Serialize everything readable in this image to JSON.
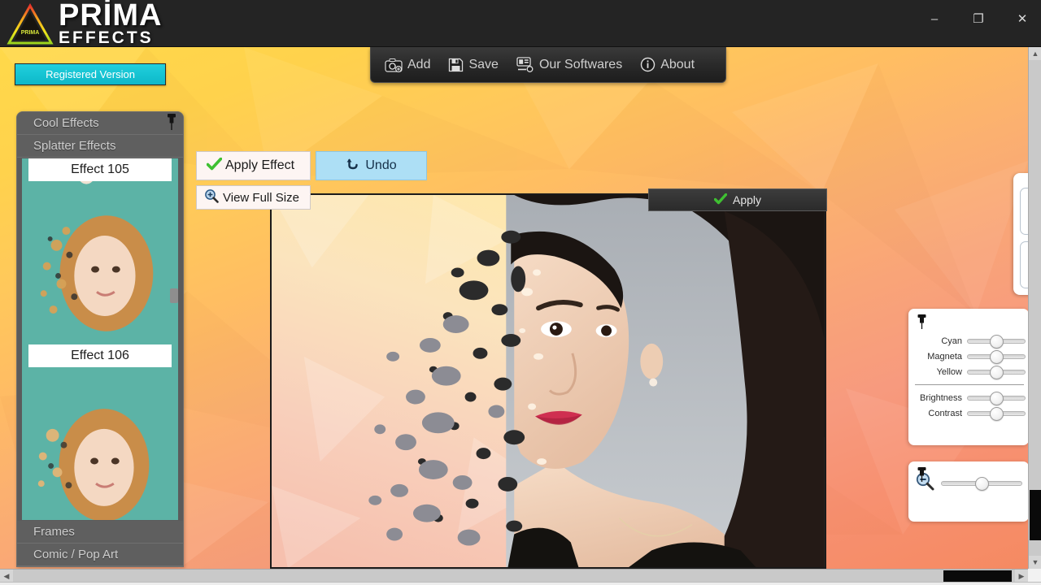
{
  "app": {
    "brand_line1": "PRİMA",
    "brand_line2": "EFFECTS",
    "logo_badge": "PRIMA",
    "accent_cyan": "#15c3d2",
    "title_bar_bg": "#242424"
  },
  "window_controls": {
    "minimize": "–",
    "restore": "❐",
    "close": "✕"
  },
  "license": {
    "button_label": "Registered Version"
  },
  "menu": {
    "items": [
      {
        "label": "Add",
        "icon": "camera-add-icon"
      },
      {
        "label": "Save",
        "icon": "floppy-disk-icon"
      },
      {
        "label": "Our Softwares",
        "icon": "apps-grid-icon"
      },
      {
        "label": "About",
        "icon": "info-circle-icon"
      }
    ]
  },
  "toolbar": {
    "apply_effect_label": "Apply Effect",
    "apply_effect_icon": "green-check-icon",
    "undo_label": "Undo",
    "undo_icon": "undo-arrow-icon",
    "view_full_size_label": "View Full Size",
    "view_full_size_icon": "magnifier-plus-icon"
  },
  "canvas": {
    "apply_button_label": "Apply",
    "apply_button_icon": "green-check-icon",
    "image_description": "Portrait photo with splatter dispersion effect"
  },
  "effects_panel": {
    "pin_icon": "pushpin-icon",
    "top_categories": [
      {
        "label": "Cool Effects"
      },
      {
        "label": "Splatter Effects"
      }
    ],
    "thumbnails": [
      {
        "label": "Effect 105"
      },
      {
        "label": "Effect 106"
      }
    ],
    "bottom_categories": [
      {
        "label": "Frames"
      },
      {
        "label": "Comic / Pop Art"
      }
    ]
  },
  "adjust_panel": {
    "pin_icon": "pushpin-icon",
    "sliders": [
      {
        "label": "Cyan",
        "value": 50
      },
      {
        "label": "Magneta",
        "value": 50
      },
      {
        "label": "Yellow",
        "value": 50
      },
      {
        "label": "Brightness",
        "value": 50
      },
      {
        "label": "Contrast",
        "value": 50
      }
    ]
  },
  "zoom_panel": {
    "pin_icon": "pushpin-icon",
    "zoom_out_icon": "magnifier-minus-icon",
    "zoom_value": 50
  },
  "scrollbars": {
    "vertical_up": "▲",
    "vertical_down": "▼",
    "horizontal_left": "◀",
    "horizontal_right": "▶"
  }
}
